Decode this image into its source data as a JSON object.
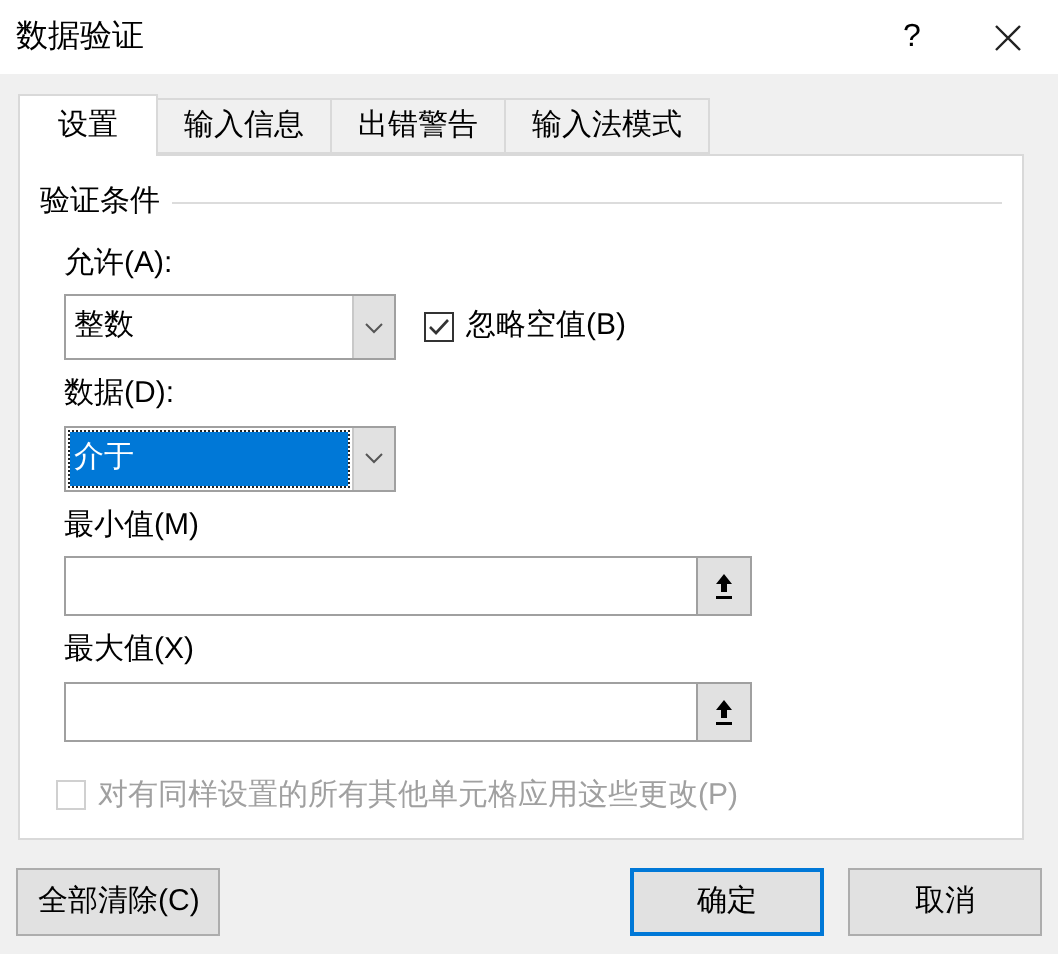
{
  "window": {
    "title": "数据验证",
    "help": "?"
  },
  "tabs": [
    {
      "label": "设置",
      "selected": true
    },
    {
      "label": "输入信息",
      "selected": false
    },
    {
      "label": "出错警告",
      "selected": false
    },
    {
      "label": "输入法模式",
      "selected": false
    }
  ],
  "group_title": "验证条件",
  "allow": {
    "label": "允许(A):",
    "value": "整数",
    "highlighted": false
  },
  "ignore_blank": {
    "label": "忽略空值(B)",
    "checked": true,
    "disabled": false
  },
  "data": {
    "label": "数据(D):",
    "value": "介于",
    "highlighted": true
  },
  "fields": [
    {
      "label": "最小值(M)"
    },
    {
      "label": "最大值(X)"
    }
  ],
  "apply_all": {
    "label": "对有同样设置的所有其他单元格应用这些更改(P)",
    "checked": false,
    "disabled": true
  },
  "buttons": [
    {
      "label": "全部清除(C)",
      "default": false
    },
    {
      "label": "确定",
      "default": true
    },
    {
      "label": "取消",
      "default": false
    }
  ]
}
